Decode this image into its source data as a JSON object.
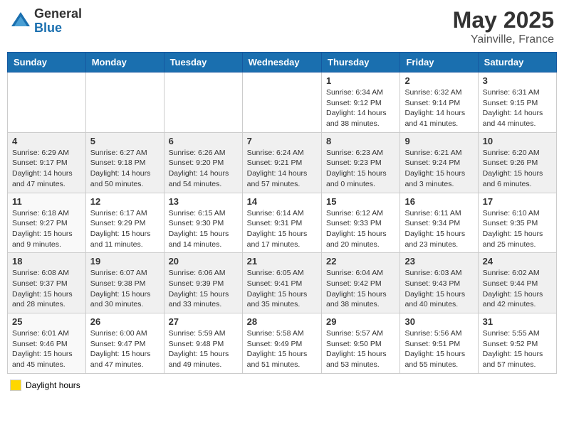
{
  "header": {
    "logo_general": "General",
    "logo_blue": "Blue",
    "title": "May 2025",
    "location": "Yainville, France"
  },
  "weekdays": [
    "Sunday",
    "Monday",
    "Tuesday",
    "Wednesday",
    "Thursday",
    "Friday",
    "Saturday"
  ],
  "weeks": [
    [
      {
        "day": "",
        "info": ""
      },
      {
        "day": "",
        "info": ""
      },
      {
        "day": "",
        "info": ""
      },
      {
        "day": "",
        "info": ""
      },
      {
        "day": "1",
        "info": "Sunrise: 6:34 AM\nSunset: 9:12 PM\nDaylight: 14 hours\nand 38 minutes."
      },
      {
        "day": "2",
        "info": "Sunrise: 6:32 AM\nSunset: 9:14 PM\nDaylight: 14 hours\nand 41 minutes."
      },
      {
        "day": "3",
        "info": "Sunrise: 6:31 AM\nSunset: 9:15 PM\nDaylight: 14 hours\nand 44 minutes."
      }
    ],
    [
      {
        "day": "4",
        "info": "Sunrise: 6:29 AM\nSunset: 9:17 PM\nDaylight: 14 hours\nand 47 minutes."
      },
      {
        "day": "5",
        "info": "Sunrise: 6:27 AM\nSunset: 9:18 PM\nDaylight: 14 hours\nand 50 minutes."
      },
      {
        "day": "6",
        "info": "Sunrise: 6:26 AM\nSunset: 9:20 PM\nDaylight: 14 hours\nand 54 minutes."
      },
      {
        "day": "7",
        "info": "Sunrise: 6:24 AM\nSunset: 9:21 PM\nDaylight: 14 hours\nand 57 minutes."
      },
      {
        "day": "8",
        "info": "Sunrise: 6:23 AM\nSunset: 9:23 PM\nDaylight: 15 hours\nand 0 minutes."
      },
      {
        "day": "9",
        "info": "Sunrise: 6:21 AM\nSunset: 9:24 PM\nDaylight: 15 hours\nand 3 minutes."
      },
      {
        "day": "10",
        "info": "Sunrise: 6:20 AM\nSunset: 9:26 PM\nDaylight: 15 hours\nand 6 minutes."
      }
    ],
    [
      {
        "day": "11",
        "info": "Sunrise: 6:18 AM\nSunset: 9:27 PM\nDaylight: 15 hours\nand 9 minutes."
      },
      {
        "day": "12",
        "info": "Sunrise: 6:17 AM\nSunset: 9:29 PM\nDaylight: 15 hours\nand 11 minutes."
      },
      {
        "day": "13",
        "info": "Sunrise: 6:15 AM\nSunset: 9:30 PM\nDaylight: 15 hours\nand 14 minutes."
      },
      {
        "day": "14",
        "info": "Sunrise: 6:14 AM\nSunset: 9:31 PM\nDaylight: 15 hours\nand 17 minutes."
      },
      {
        "day": "15",
        "info": "Sunrise: 6:12 AM\nSunset: 9:33 PM\nDaylight: 15 hours\nand 20 minutes."
      },
      {
        "day": "16",
        "info": "Sunrise: 6:11 AM\nSunset: 9:34 PM\nDaylight: 15 hours\nand 23 minutes."
      },
      {
        "day": "17",
        "info": "Sunrise: 6:10 AM\nSunset: 9:35 PM\nDaylight: 15 hours\nand 25 minutes."
      }
    ],
    [
      {
        "day": "18",
        "info": "Sunrise: 6:08 AM\nSunset: 9:37 PM\nDaylight: 15 hours\nand 28 minutes."
      },
      {
        "day": "19",
        "info": "Sunrise: 6:07 AM\nSunset: 9:38 PM\nDaylight: 15 hours\nand 30 minutes."
      },
      {
        "day": "20",
        "info": "Sunrise: 6:06 AM\nSunset: 9:39 PM\nDaylight: 15 hours\nand 33 minutes."
      },
      {
        "day": "21",
        "info": "Sunrise: 6:05 AM\nSunset: 9:41 PM\nDaylight: 15 hours\nand 35 minutes."
      },
      {
        "day": "22",
        "info": "Sunrise: 6:04 AM\nSunset: 9:42 PM\nDaylight: 15 hours\nand 38 minutes."
      },
      {
        "day": "23",
        "info": "Sunrise: 6:03 AM\nSunset: 9:43 PM\nDaylight: 15 hours\nand 40 minutes."
      },
      {
        "day": "24",
        "info": "Sunrise: 6:02 AM\nSunset: 9:44 PM\nDaylight: 15 hours\nand 42 minutes."
      }
    ],
    [
      {
        "day": "25",
        "info": "Sunrise: 6:01 AM\nSunset: 9:46 PM\nDaylight: 15 hours\nand 45 minutes."
      },
      {
        "day": "26",
        "info": "Sunrise: 6:00 AM\nSunset: 9:47 PM\nDaylight: 15 hours\nand 47 minutes."
      },
      {
        "day": "27",
        "info": "Sunrise: 5:59 AM\nSunset: 9:48 PM\nDaylight: 15 hours\nand 49 minutes."
      },
      {
        "day": "28",
        "info": "Sunrise: 5:58 AM\nSunset: 9:49 PM\nDaylight: 15 hours\nand 51 minutes."
      },
      {
        "day": "29",
        "info": "Sunrise: 5:57 AM\nSunset: 9:50 PM\nDaylight: 15 hours\nand 53 minutes."
      },
      {
        "day": "30",
        "info": "Sunrise: 5:56 AM\nSunset: 9:51 PM\nDaylight: 15 hours\nand 55 minutes."
      },
      {
        "day": "31",
        "info": "Sunrise: 5:55 AM\nSunset: 9:52 PM\nDaylight: 15 hours\nand 57 minutes."
      }
    ]
  ],
  "legend": {
    "box_color": "#ffd700",
    "label": "Daylight hours"
  }
}
